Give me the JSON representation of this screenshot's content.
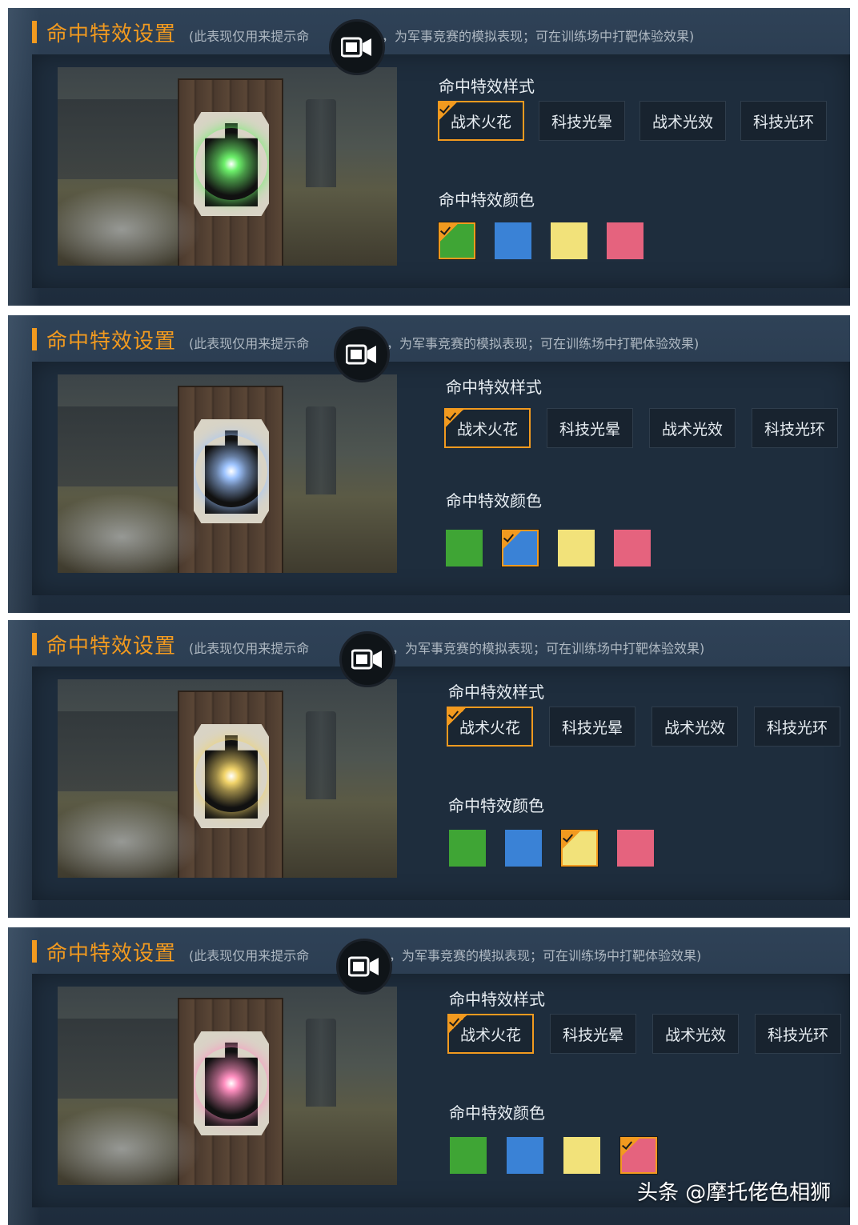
{
  "panels": [
    {
      "title": "命中特效设置",
      "subtitle_left": "(此表现仅用来提示命",
      "subtitle_right": "，为军事竞赛的模拟表现；可在训练场中打靶体验效果)",
      "style_label": "命中特效样式",
      "styles": [
        "战术火花",
        "科技光晕",
        "战术光效",
        "科技光环"
      ],
      "selected_style": 0,
      "color_label": "命中特效颜色",
      "colors": [
        "#3fa535",
        "#3a82d6",
        "#f2e27a",
        "#e5637e"
      ],
      "selected_color": 0,
      "spark_color": "#6cf06a"
    },
    {
      "title": "命中特效设置",
      "subtitle_left": "(此表现仅用来提示命",
      "subtitle_right": "，为军事竞赛的模拟表现；可在训练场中打靶体验效果)",
      "style_label": "命中特效样式",
      "styles": [
        "战术火花",
        "科技光晕",
        "战术光效",
        "科技光环"
      ],
      "selected_style": 0,
      "color_label": "命中特效颜色",
      "colors": [
        "#3fa535",
        "#3a82d6",
        "#f2e27a",
        "#e5637e"
      ],
      "selected_color": 1,
      "spark_color": "#9ec4ff"
    },
    {
      "title": "命中特效设置",
      "subtitle_left": "(此表现仅用来提示命",
      "subtitle_right": "，为军事竞赛的模拟表现；可在训练场中打靶体验效果)",
      "style_label": "命中特效样式",
      "styles": [
        "战术火花",
        "科技光晕",
        "战术光效",
        "科技光环"
      ],
      "selected_style": 0,
      "color_label": "命中特效颜色",
      "colors": [
        "#3fa535",
        "#3a82d6",
        "#f2e27a",
        "#e5637e"
      ],
      "selected_color": 2,
      "spark_color": "#f2d46a"
    },
    {
      "title": "命中特效设置",
      "subtitle_left": "(此表现仅用来提示命",
      "subtitle_right": "，为军事竞赛的模拟表现；可在训练场中打靶体验效果)",
      "style_label": "命中特效样式",
      "styles": [
        "战术火花",
        "科技光晕",
        "战术光效",
        "科技光环"
      ],
      "selected_style": 0,
      "color_label": "命中特效颜色",
      "colors": [
        "#3fa535",
        "#3a82d6",
        "#f2e27a",
        "#e5637e"
      ],
      "selected_color": 3,
      "spark_color": "#ff8fc0"
    }
  ],
  "icons": {
    "video": "video-camera-icon",
    "check": "checkmark-icon"
  },
  "accent_color": "#f29a1f",
  "watermark": "头条 @摩托佬色相狮"
}
